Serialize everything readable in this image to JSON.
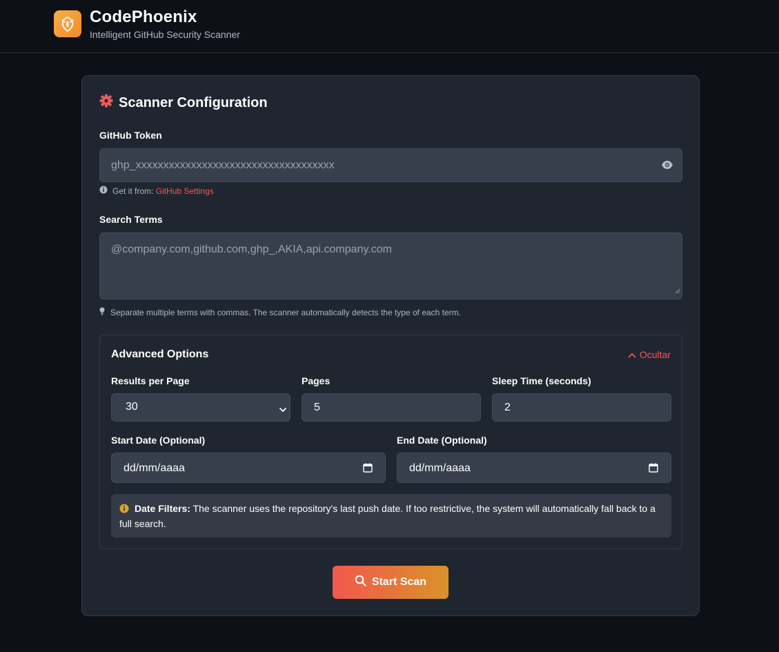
{
  "brand": {
    "name": "CodePhoenix",
    "tagline": "Intelligent GitHub Security Scanner"
  },
  "card": {
    "title": "Scanner Configuration"
  },
  "token": {
    "label": "GitHub Token",
    "placeholder": "ghp_xxxxxxxxxxxxxxxxxxxxxxxxxxxxxxxxxxxx",
    "hint_prefix": "Get it from:",
    "hint_link": "GitHub Settings"
  },
  "terms": {
    "label": "Search Terms",
    "placeholder": "@company.com,github.com,ghp_,AKIA,api.company.com",
    "hint": "Separate multiple terms with commas. The scanner automatically detects the type of each term."
  },
  "advanced": {
    "title": "Advanced Options",
    "toggle_label": "Ocultar",
    "results_per_page": {
      "label": "Results per Page",
      "value": "30"
    },
    "pages": {
      "label": "Pages",
      "value": "5"
    },
    "sleep_time": {
      "label": "Sleep Time (seconds)",
      "value": "2"
    },
    "start_date": {
      "label": "Start Date (Optional)",
      "placeholder": "dd/mm/aaaa"
    },
    "end_date": {
      "label": "End Date (Optional)",
      "placeholder": "dd/mm/aaaa"
    },
    "note_title": "Date Filters:",
    "note_text": "The scanner uses the repository's last push date. If too restrictive, the system will automatically fall back to a full search."
  },
  "actions": {
    "start_scan": "Start Scan"
  },
  "colors": {
    "accent_red": "#f25a5a",
    "logo_orange": "#f08a24",
    "button_start": "#f2584f",
    "button_end": "#d99228"
  },
  "icons": {
    "logo": "phoenix-icon",
    "config": "gear-icon",
    "reveal": "eye-icon",
    "info": "info-icon",
    "tip": "lightbulb-icon",
    "collapse": "chevron-up-icon",
    "select": "chevron-down-icon",
    "date": "calendar-icon",
    "scan": "search-icon"
  }
}
